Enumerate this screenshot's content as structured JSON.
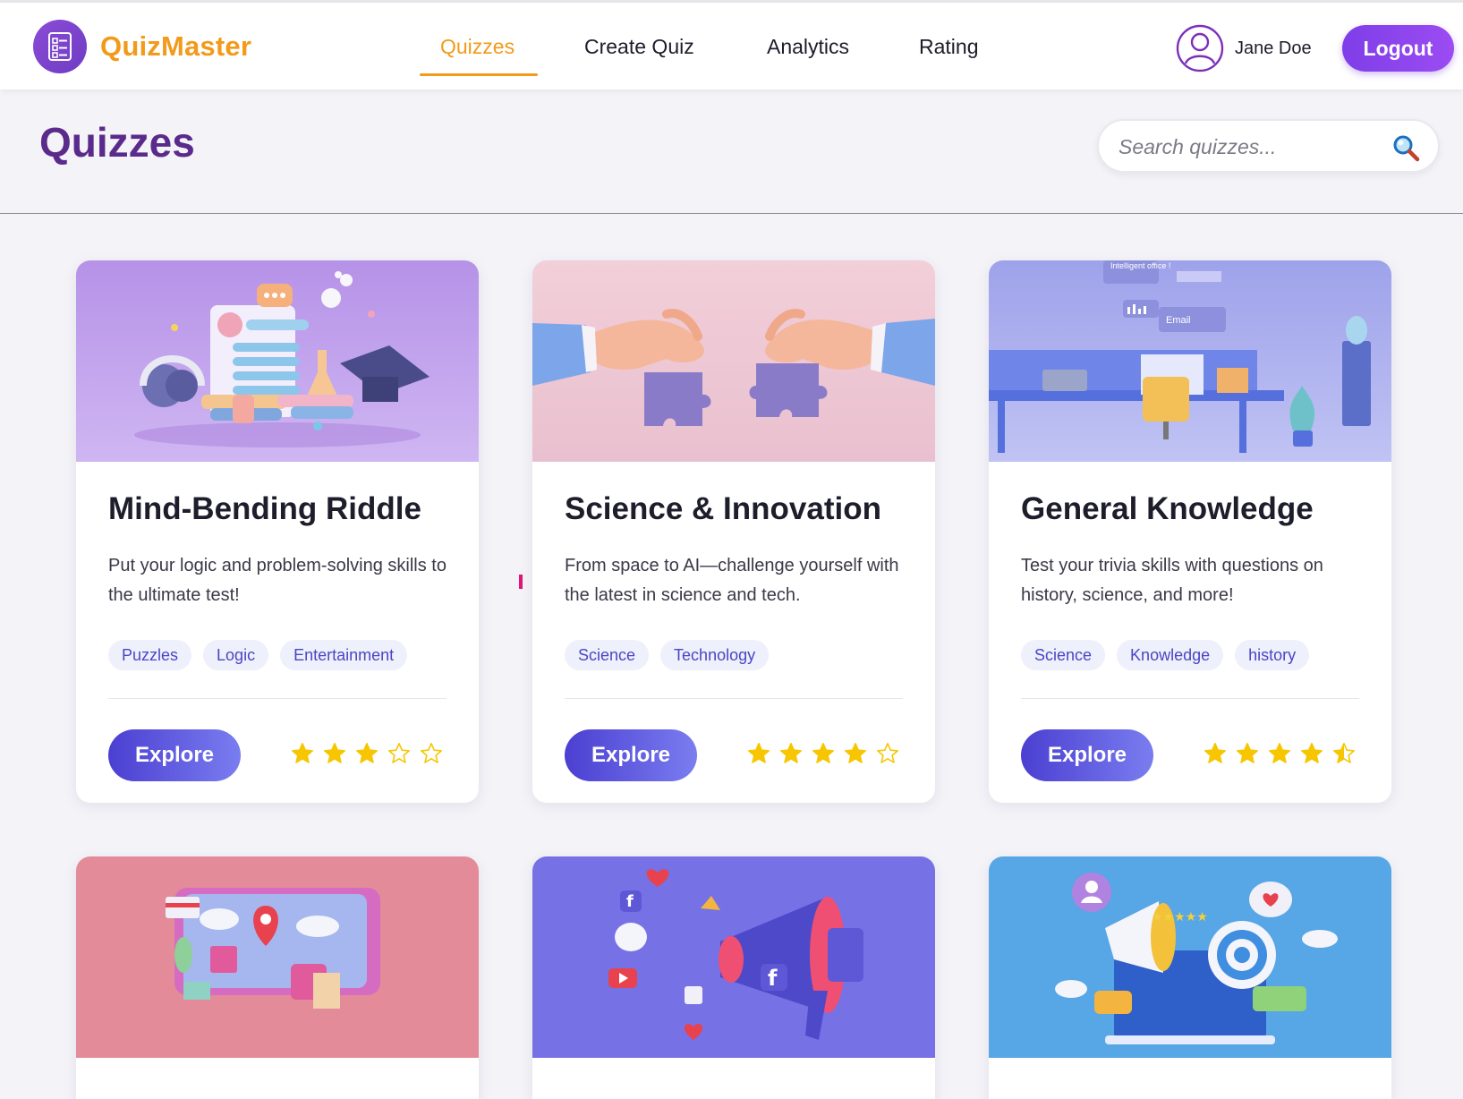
{
  "app": {
    "brand": "QuizMaster",
    "accent": "#f29a1a",
    "primary": "#7f3ee8"
  },
  "nav": {
    "links": [
      "Quizzes",
      "Create Quiz",
      "Analytics",
      "Rating"
    ],
    "active": "Quizzes"
  },
  "user": {
    "name": "Jane Doe",
    "logout_label": "Logout"
  },
  "page": {
    "title": "Quizzes"
  },
  "search": {
    "placeholder": "Search quizzes..."
  },
  "cards": [
    {
      "title": "Mind-Bending Riddle",
      "description": "Put your logic and problem-solving skills to the ultimate test!",
      "tags": [
        "Puzzles",
        "Logic",
        "Entertainment"
      ],
      "button": "Explore",
      "rating": 3,
      "image": "study-objects-illustration"
    },
    {
      "title": "Science & Innovation",
      "description": "From space to AI—challenge yourself with the latest in science and tech.",
      "tags": [
        "Science",
        "Technology"
      ],
      "button": "Explore",
      "rating": 4,
      "image": "puzzle-hands-illustration"
    },
    {
      "title": "General Knowledge",
      "description": "Test your trivia skills with questions on history, science, and more!",
      "tags": [
        "Science",
        "Knowledge",
        "history"
      ],
      "button": "Explore",
      "rating": 4.5,
      "image": "office-illustration"
    },
    {
      "image": "map-shopping-illustration"
    },
    {
      "image": "megaphone-social-illustration"
    },
    {
      "image": "marketing-target-illustration"
    }
  ],
  "image_labels": {
    "office_sign": "Intelligent office !",
    "email_chip": "Email"
  }
}
